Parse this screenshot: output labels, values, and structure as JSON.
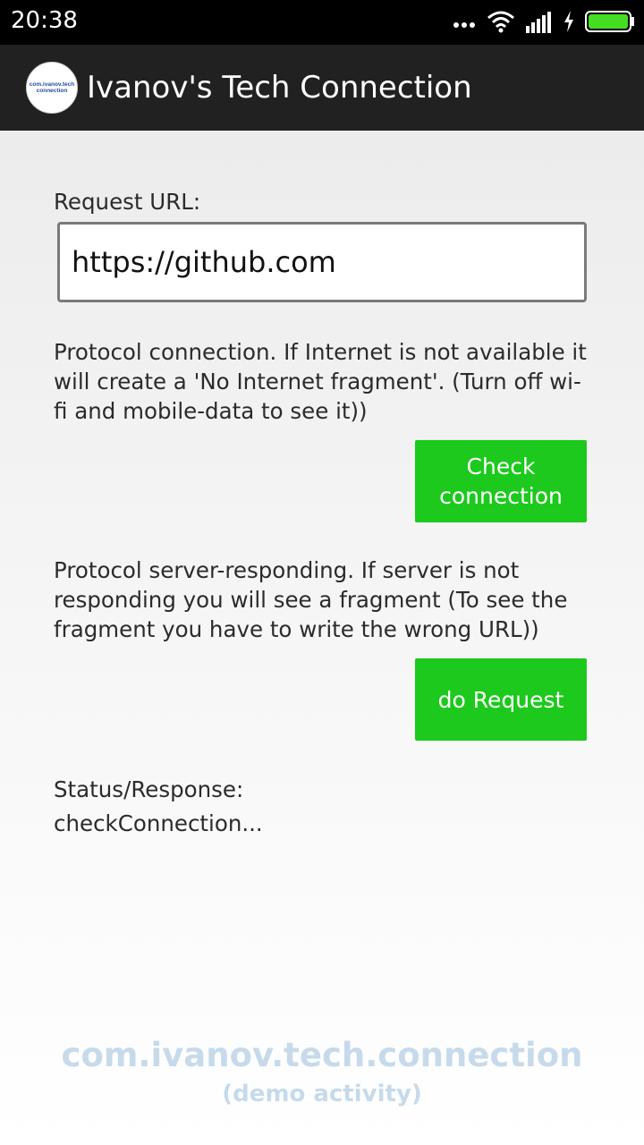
{
  "status_bar": {
    "time": "20:38",
    "icons": [
      "more-dots-icon",
      "wifi-icon",
      "signal-icon",
      "charging-icon",
      "battery-icon"
    ],
    "battery_color": "#44dd22"
  },
  "app_bar": {
    "logo_text_line1": "com.ivanov.tech",
    "logo_text_line2": "connection",
    "title": "Ivanov's Tech Connection"
  },
  "form": {
    "url_label": "Request URL:",
    "url_value": "https://github.com",
    "connection_description": "Protocol connection. If Internet is not available it will create a 'No Internet fragment'. (Turn off wi-fi and mobile-data to see it))",
    "check_button_label": "Check connection",
    "request_description": "Protocol server-responding. If server is not responding you will see a fragment (To see the fragment you have to write the wrong URL))",
    "request_button_label": "do Request",
    "status_label": "Status/Response:",
    "status_value": "checkConnection..."
  },
  "watermark": {
    "package": "com.ivanov.tech.connection",
    "subtitle": "(demo activity)"
  },
  "colors": {
    "accent_button": "#1dc91d",
    "app_bar": "#212121",
    "watermark": "#c6daeb"
  }
}
